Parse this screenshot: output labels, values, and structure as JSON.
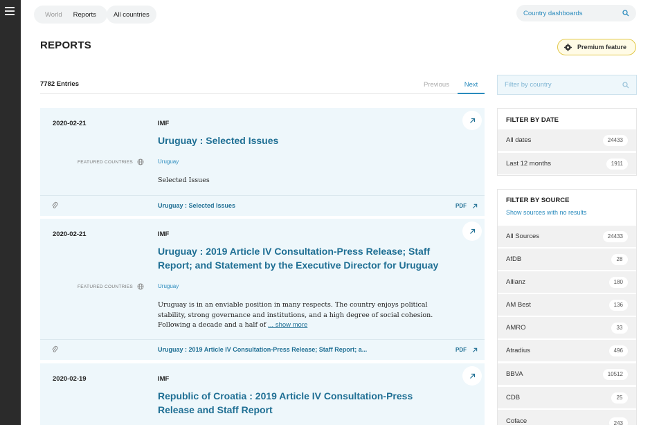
{
  "nav": {
    "crumbs": [
      "World",
      "Reports"
    ],
    "all_countries": "All countries",
    "dashboard_search": "Country dashboards"
  },
  "page": {
    "title": "REPORTS",
    "premium": "Premium feature",
    "entries": "7782 Entries",
    "previous": "Previous",
    "next": "Next"
  },
  "reports": [
    {
      "date": "2020-02-21",
      "source": "IMF",
      "title": "Uruguay : Selected Issues",
      "featured_label": "FEATURED COUNTRIES",
      "country": "Uruguay",
      "description": "Selected Issues",
      "show_more": "",
      "doc": "Uruguay : Selected Issues",
      "pdf": "PDF"
    },
    {
      "date": "2020-02-21",
      "source": "IMF",
      "title": "Uruguay : 2019 Article IV Consultation-Press Release; Staff Report; and Statement by the Executive Director for Uruguay",
      "featured_label": "FEATURED COUNTRIES",
      "country": "Uruguay",
      "description": "Uruguay is in an enviable position in many respects. The country enjoys political stability, strong governance and institutions, and a high degree of social cohesion. Following a decade and a half of",
      "show_more": "... show more",
      "doc": "Uruguay : 2019 Article IV Consultation-Press Release; Staff Report; a...",
      "pdf": "PDF"
    },
    {
      "date": "2020-02-19",
      "source": "IMF",
      "title": "Republic of Croatia : 2019 Article IV Consultation-Press Release and Staff Report"
    }
  ],
  "filters": {
    "country_placeholder": "Filter by country",
    "date_title": "FILTER BY DATE",
    "dates": [
      {
        "label": "All dates",
        "count": "24433"
      },
      {
        "label": "Last 12 months",
        "count": "1911"
      }
    ],
    "source_title": "FILTER BY SOURCE",
    "show_no_results": "Show sources with no results",
    "sources": [
      {
        "label": "All Sources",
        "count": "24433"
      },
      {
        "label": "AfDB",
        "count": "28"
      },
      {
        "label": "Allianz",
        "count": "180"
      },
      {
        "label": "AM Best",
        "count": "136"
      },
      {
        "label": "AMRO",
        "count": "33"
      },
      {
        "label": "Atradius",
        "count": "496"
      },
      {
        "label": "BBVA",
        "count": "10512"
      },
      {
        "label": "CDB",
        "count": "25"
      },
      {
        "label": "Coface",
        "count": "243"
      }
    ]
  }
}
